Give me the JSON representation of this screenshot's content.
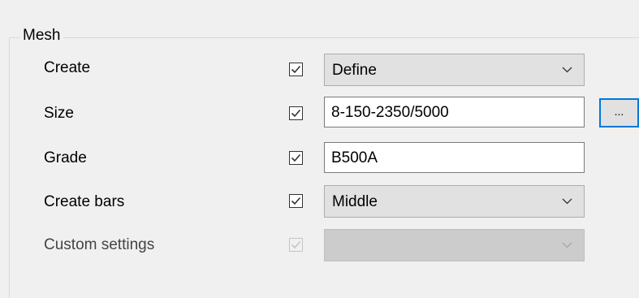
{
  "group": {
    "title": "Mesh"
  },
  "rows": [
    {
      "label": "Create",
      "checked": true,
      "control": "combo",
      "value": "Define",
      "enabled": true
    },
    {
      "label": "Size",
      "checked": true,
      "control": "text",
      "value": "8-150-2350/5000",
      "enabled": true
    },
    {
      "label": "Grade",
      "checked": true,
      "control": "text",
      "value": "B500A",
      "enabled": true
    },
    {
      "label": "Create bars",
      "checked": true,
      "control": "combo",
      "value": "Middle",
      "enabled": true
    },
    {
      "label": "Custom settings",
      "checked": true,
      "control": "combo",
      "value": "",
      "enabled": false
    }
  ],
  "browse_button": {
    "label": "..."
  },
  "icons": {
    "checkbox": "checkmark-icon",
    "dropdown": "chevron-down-icon"
  }
}
